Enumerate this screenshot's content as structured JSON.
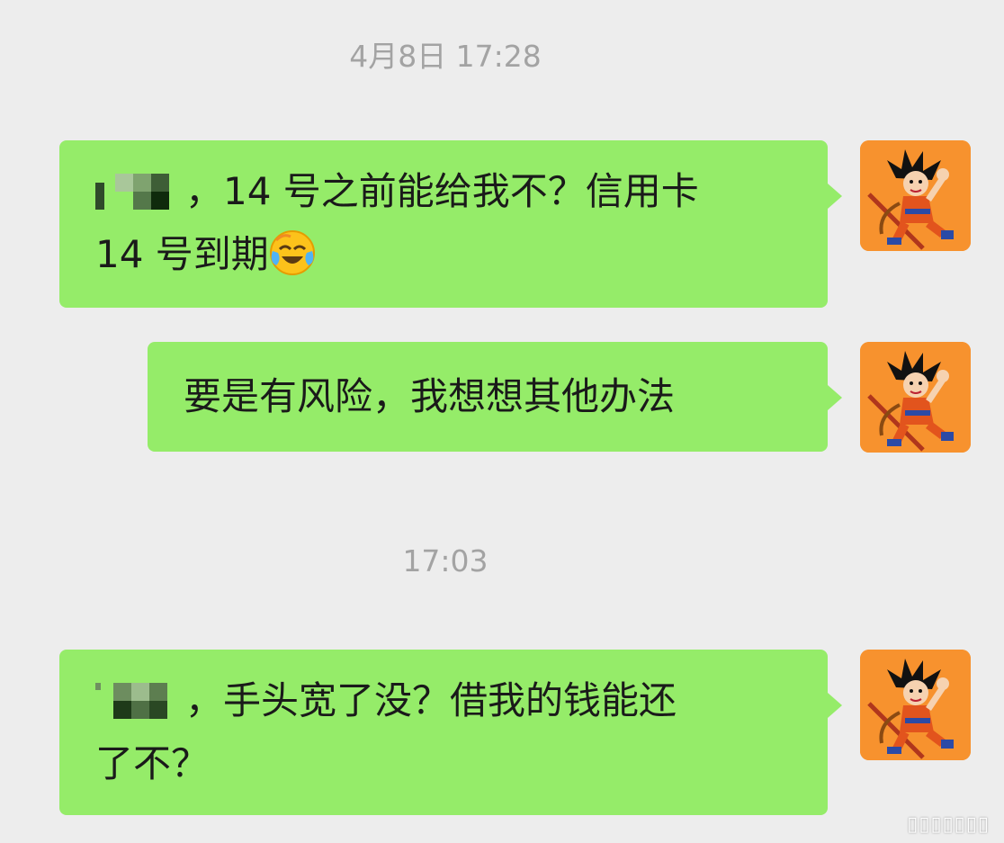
{
  "chat": {
    "timestamps": [
      "4月8日 17:28",
      "17:03"
    ],
    "messages": [
      {
        "sender": "self",
        "text_line1": "，14 号之前能给我不？信用卡",
        "text_line2": "14 号到期",
        "emoji": "face-with-tears-of-joy"
      },
      {
        "sender": "self",
        "text": "要是有风险，我想想其他办法"
      },
      {
        "sender": "self",
        "text_line1": "，手头宽了没？借我的钱能还",
        "text_line2": "了不？"
      }
    ]
  },
  "colors": {
    "background": "#ededed",
    "bubble": "#95ec69",
    "avatar_bg": "#f7922e",
    "timestamp": "#a3a3a3"
  },
  "avatar": {
    "icon": "cartoon-boy-avatar"
  },
  "watermark_glyphs": "▯▯▯▯▯▯▯"
}
